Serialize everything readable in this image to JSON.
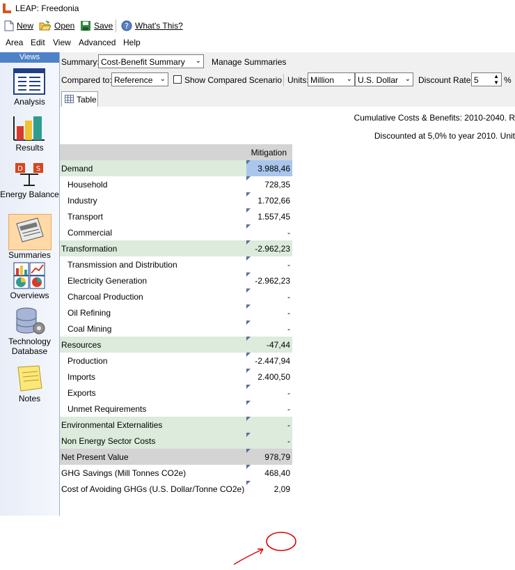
{
  "window": {
    "title": "LEAP: Freedonia"
  },
  "toolbar": {
    "new_label": "New",
    "open_label": "Open",
    "save_label": "Save",
    "whats_this_label": "What's This?"
  },
  "menubar": {
    "items": [
      "Area",
      "Edit",
      "View",
      "Advanced",
      "Help"
    ]
  },
  "sidebar": {
    "header": "Views",
    "items": [
      {
        "label": "Analysis",
        "icon": "analysis-icon"
      },
      {
        "label": "Results",
        "icon": "results-icon"
      },
      {
        "label": "Energy Balance",
        "icon": "energy-balance-icon"
      },
      {
        "label": "Summaries",
        "icon": "summaries-icon",
        "active": true
      },
      {
        "label": "Overviews",
        "icon": "overviews-icon"
      },
      {
        "label": "Technology Database",
        "icon": "technology-database-icon"
      },
      {
        "label": "Notes",
        "icon": "notes-icon"
      }
    ]
  },
  "controls": {
    "summary_label": "Summary:",
    "summary_value": "Cost-Benefit Summary",
    "manage_summaries": "Manage Summaries",
    "compared_to_label": "Compared to:",
    "compared_to_value": "Reference",
    "show_compared_scenario": "Show Compared Scenario",
    "units_label": "Units:",
    "units_scale": "Million",
    "units_currency": "U.S. Dollar",
    "discount_rate_label": "Discount Rate:",
    "discount_rate_value": "5",
    "discount_rate_unit": "%"
  },
  "tabs": {
    "table_label": "Table"
  },
  "report": {
    "header_line1": "Cumulative Costs & Benefits: 2010-2040. R",
    "header_line2": "Discounted at 5,0% to year 2010.  Unit",
    "column_header": "Mitigation",
    "rows": [
      {
        "label": "Demand",
        "value": "3.988,46",
        "level": 0,
        "style": "green",
        "highlight": true
      },
      {
        "label": "Household",
        "value": "728,35",
        "level": 1,
        "style": "white"
      },
      {
        "label": "Industry",
        "value": "1.702,66",
        "level": 1,
        "style": "white"
      },
      {
        "label": "Transport",
        "value": "1.557,45",
        "level": 1,
        "style": "white"
      },
      {
        "label": "Commercial",
        "value": "-",
        "level": 1,
        "style": "white"
      },
      {
        "label": "Transformation",
        "value": "-2.962,23",
        "level": 0,
        "style": "green"
      },
      {
        "label": "Transmission and Distribution",
        "value": "-",
        "level": 1,
        "style": "white"
      },
      {
        "label": "Electricity Generation",
        "value": "-2.962,23",
        "level": 1,
        "style": "white"
      },
      {
        "label": "Charcoal Production",
        "value": "-",
        "level": 1,
        "style": "white"
      },
      {
        "label": "Oil Refining",
        "value": "-",
        "level": 1,
        "style": "white"
      },
      {
        "label": "Coal Mining",
        "value": "-",
        "level": 1,
        "style": "white"
      },
      {
        "label": "Resources",
        "value": "-47,44",
        "level": 0,
        "style": "green"
      },
      {
        "label": "Production",
        "value": "-2.447,94",
        "level": 1,
        "style": "white"
      },
      {
        "label": "Imports",
        "value": "2.400,50",
        "level": 1,
        "style": "white"
      },
      {
        "label": "Exports",
        "value": "-",
        "level": 1,
        "style": "white"
      },
      {
        "label": "Unmet Requirements",
        "value": "-",
        "level": 1,
        "style": "white"
      },
      {
        "label": "Environmental Externalities",
        "value": "-",
        "level": 0,
        "style": "green"
      },
      {
        "label": "Non Energy Sector Costs",
        "value": "-",
        "level": 0,
        "style": "green"
      },
      {
        "label": "Net Present Value",
        "value": "978,79",
        "level": 0,
        "style": "grey"
      },
      {
        "label": "GHG Savings (Mill Tonnes CO2e)",
        "value": "468,40",
        "level": 0,
        "style": "white"
      },
      {
        "label": "Cost of Avoiding GHGs (U.S. Dollar/Tonne CO2e)",
        "value": "2,09",
        "level": 0,
        "style": "white",
        "annotated": true
      }
    ]
  },
  "colors": {
    "accent": "#4f81c7",
    "group_row": "#dcebdc",
    "total_row": "#d4d4d4",
    "selected_cell": "#a9c6ec",
    "annotation": "#e00000"
  }
}
